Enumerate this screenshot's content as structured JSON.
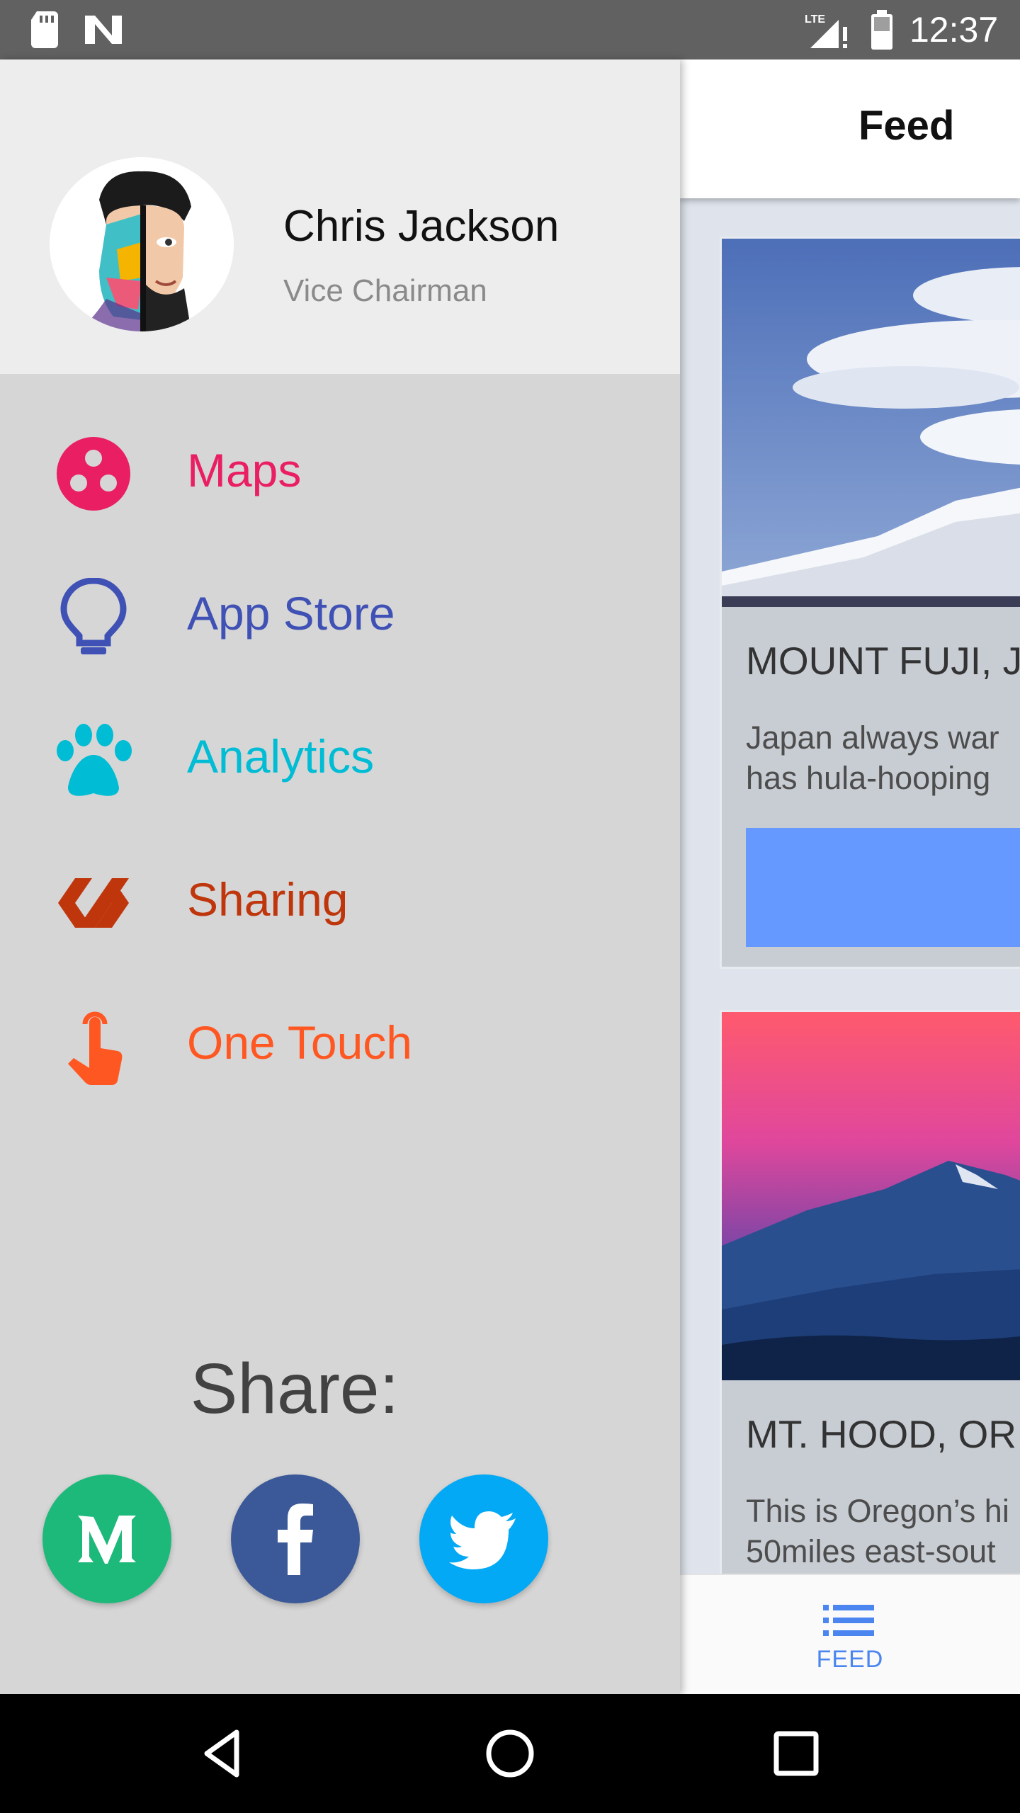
{
  "status_bar": {
    "time": "12:37",
    "network": "LTE"
  },
  "main": {
    "title": "Feed",
    "cards": [
      {
        "title": "MOUNT FUJI, J",
        "text_line1": "Japan always war",
        "text_line2": "has hula-hooping"
      },
      {
        "title": "MT. HOOD, OR",
        "text_line1": "This is Oregon’s hi",
        "text_line2": "50miles east-sout"
      }
    ],
    "bottom_nav": {
      "label": "FEED"
    }
  },
  "drawer": {
    "user": {
      "name": "Chris Jackson",
      "role": "Vice Chairman"
    },
    "menu": [
      {
        "label": "Maps",
        "color": "#e91e63"
      },
      {
        "label": "App Store",
        "color": "#3f51b5"
      },
      {
        "label": "Analytics",
        "color": "#00bcd4"
      },
      {
        "label": "Sharing",
        "color": "#bf360c"
      },
      {
        "label": "One Touch",
        "color": "#ff5722"
      }
    ],
    "share_label": "Share:",
    "share_buttons": [
      {
        "icon": "medium-icon",
        "color": "#1db97a"
      },
      {
        "icon": "facebook-icon",
        "color": "#3b5998"
      },
      {
        "icon": "twitter-icon",
        "color": "#03a9f4"
      }
    ]
  }
}
